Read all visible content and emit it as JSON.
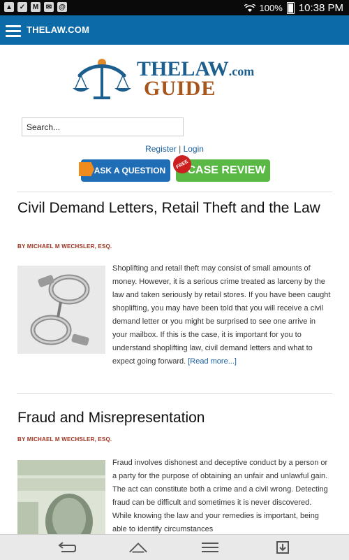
{
  "status_bar": {
    "battery": "100%",
    "time": "10:38 PM"
  },
  "app_bar": {
    "title": "THELAW.COM"
  },
  "logo": {
    "line1": "THELAW",
    "line1_suffix": ".com",
    "line2": "GUIDE"
  },
  "search": {
    "placeholder": "Search..."
  },
  "auth": {
    "register": "Register",
    "separator": "|",
    "login": "Login"
  },
  "buttons": {
    "ask": "ASK A QUESTION",
    "case_review": "CASE REVIEW",
    "free_badge": "FREE"
  },
  "articles": [
    {
      "title": "Civil Demand Letters, Retail Theft and the Law",
      "byline": "BY MICHAEL M WECHSLER, ESQ.",
      "excerpt": "Shoplifting and retail theft may consist of small amounts of money. However, it is a serious crime treated as larceny by the law and taken seriously by retail stores. If you have been caught shoplifting, you may have been told that you will receive a civil demand letter or you might be surprised to see one arrive in your mailbox. If this is the case, it is important for you to understand shoplifting law, civil demand letters and what to expect going forward.",
      "read_more": "[Read more...]"
    },
    {
      "title": "Fraud and Misrepresentation",
      "byline": "BY MICHAEL M WECHSLER, ESQ.",
      "excerpt": "Fraud involves dishonest and deceptive conduct by a person or a party for the purpose of obtaining an unfair and unlawful gain. The act can constitute both a crime and a civil wrong. Detecting fraud can be difficult and sometimes it is never discovered. While knowing the law and your remedies is important, being able to identify circumstances"
    }
  ],
  "colors": {
    "app_bar": "#0c6aa8",
    "byline": "#a0301e",
    "link": "#1a5fa0",
    "ask_button": "#1f6db5",
    "case_button": "#5ab845"
  }
}
